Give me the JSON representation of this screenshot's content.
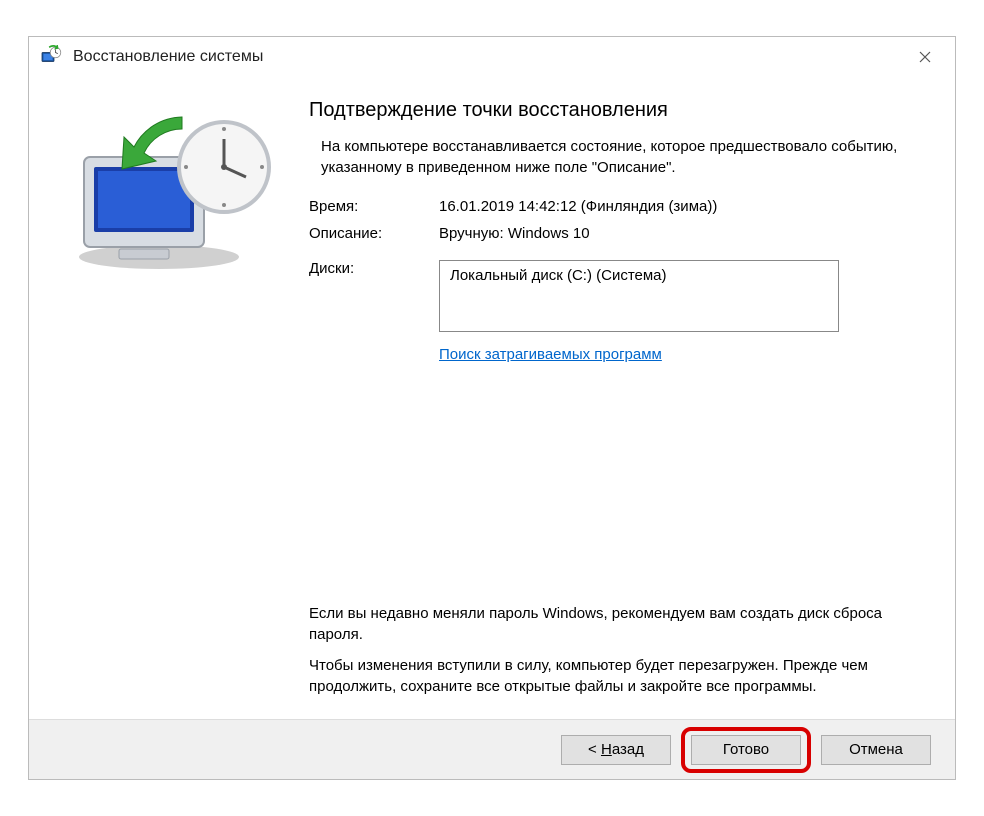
{
  "window": {
    "title": "Восстановление системы"
  },
  "page": {
    "title": "Подтверждение точки восстановления",
    "intro": "На компьютере восстанавливается состояние, которое предшествовало событию, указанному в приведенном ниже поле \"Описание\"."
  },
  "fields": {
    "time_label": "Время:",
    "time_value": "16.01.2019 14:42:12 (Финляндия (зима))",
    "desc_label": "Описание:",
    "desc_value": "Вручную: Windows 10",
    "disks_label": "Диски:",
    "disks_value": "Локальный диск (C:) (Система)"
  },
  "link": {
    "scan_affected": "Поиск затрагиваемых программ"
  },
  "footer": {
    "p1": "Если вы недавно меняли пароль Windows, рекомендуем вам создать диск сброса пароля.",
    "p2": "Чтобы изменения вступили в силу, компьютер будет перезагружен. Прежде чем продолжить, сохраните все открытые файлы и закройте все программы."
  },
  "buttons": {
    "back_prefix": "< ",
    "back_u": "Н",
    "back_rest": "азад",
    "finish": "Готово",
    "cancel": "Отмена"
  }
}
